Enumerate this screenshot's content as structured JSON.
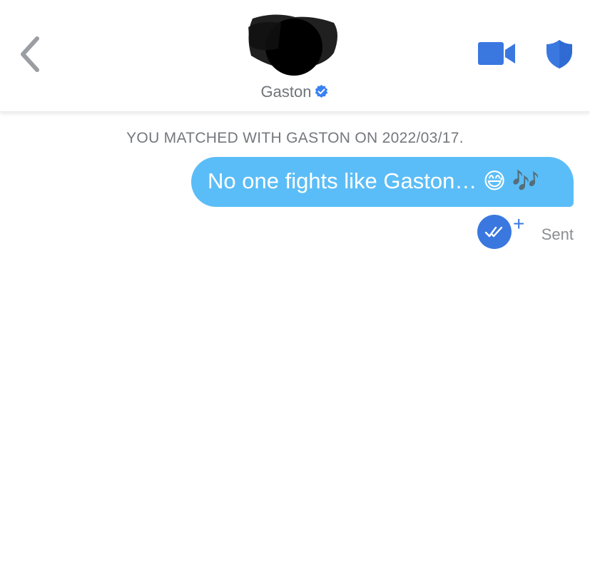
{
  "header": {
    "contact_name": "Gaston",
    "verified": true
  },
  "chat": {
    "match_notice": "YOU MATCHED WITH GASTON ON 2022/03/17.",
    "messages": [
      {
        "text": "No one fights like Gaston… 😅 🎶",
        "from": "me",
        "status": "Sent"
      }
    ]
  },
  "icons": {
    "back": "chevron-left-icon",
    "video": "video-camera-icon",
    "safety": "shield-icon",
    "verified": "verified-badge-icon",
    "receipt": "double-check-icon",
    "plus": "plus-icon"
  },
  "colors": {
    "accent_blue": "#3a78e0",
    "bubble_blue": "#5bbdf7",
    "text_gray": "#74787c"
  }
}
